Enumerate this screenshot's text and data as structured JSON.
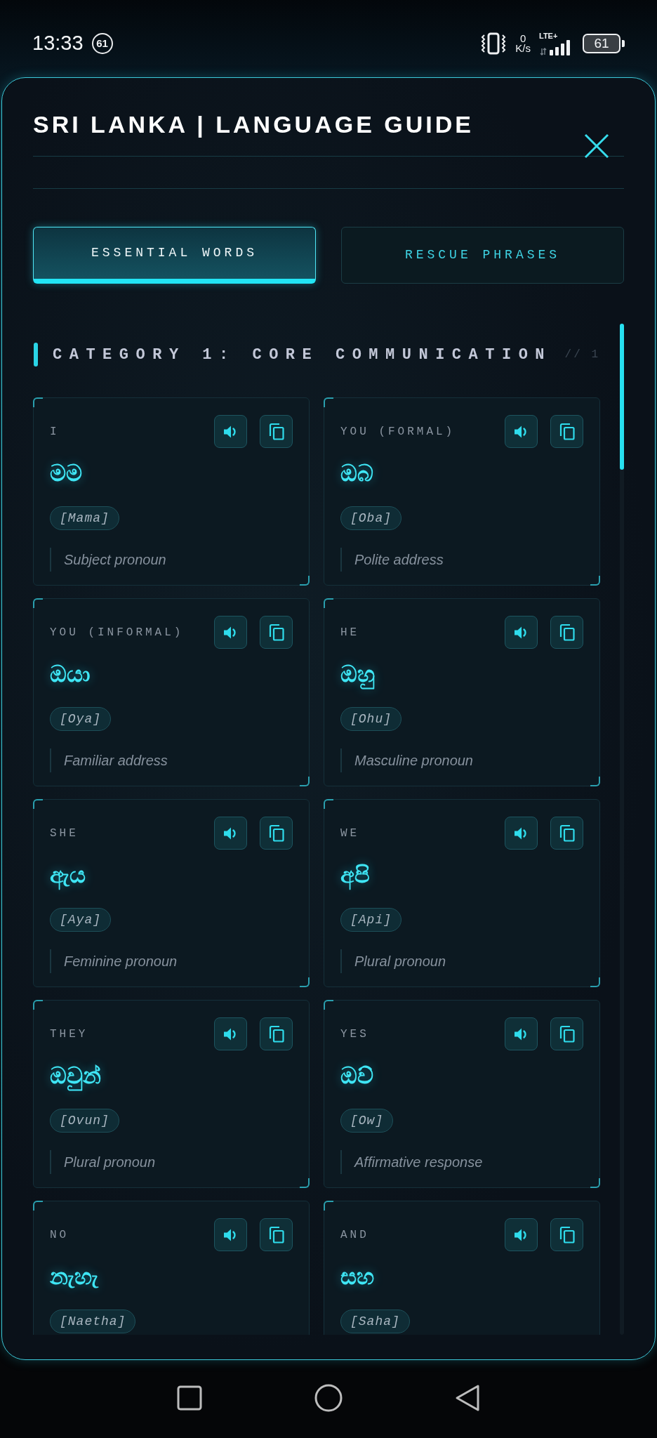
{
  "status_bar": {
    "time": "13:33",
    "notification_count": "61",
    "speed_value": "0",
    "speed_unit": "K/s",
    "network_type": "LTE+",
    "battery": "61"
  },
  "modal": {
    "title": "SRI LANKA | LANGUAGE GUIDE",
    "tabs": [
      {
        "label": "ESSENTIAL WORDS",
        "selected": true
      },
      {
        "label": "RESCUE PHRASES",
        "selected": false
      }
    ],
    "category": {
      "title": "CATEGORY 1: CORE COMMUNICATION",
      "index": "// 1"
    },
    "cards": [
      {
        "english": "I",
        "sinhala": "මම",
        "romanized": "[Mama]",
        "note": "Subject pronoun"
      },
      {
        "english": "YOU (FORMAL)",
        "sinhala": "ඔබ",
        "romanized": "[Oba]",
        "note": "Polite address"
      },
      {
        "english": "YOU (INFORMAL)",
        "sinhala": "ඔයා",
        "romanized": "[Oya]",
        "note": "Familiar address"
      },
      {
        "english": "HE",
        "sinhala": "ඔහු",
        "romanized": "[Ohu]",
        "note": "Masculine pronoun"
      },
      {
        "english": "SHE",
        "sinhala": "ඇය",
        "romanized": "[Aya]",
        "note": "Feminine pronoun"
      },
      {
        "english": "WE",
        "sinhala": "අපි",
        "romanized": "[Api]",
        "note": "Plural pronoun"
      },
      {
        "english": "THEY",
        "sinhala": "ඔවුන්",
        "romanized": "[Ovun]",
        "note": "Plural pronoun"
      },
      {
        "english": "YES",
        "sinhala": "ඔව්",
        "romanized": "[Ow]",
        "note": "Affirmative response"
      },
      {
        "english": "NO",
        "sinhala": "නැහැ",
        "romanized": "[Naetha]"
      },
      {
        "english": "AND",
        "sinhala": "සහ",
        "romanized": "[Saha]"
      }
    ]
  }
}
